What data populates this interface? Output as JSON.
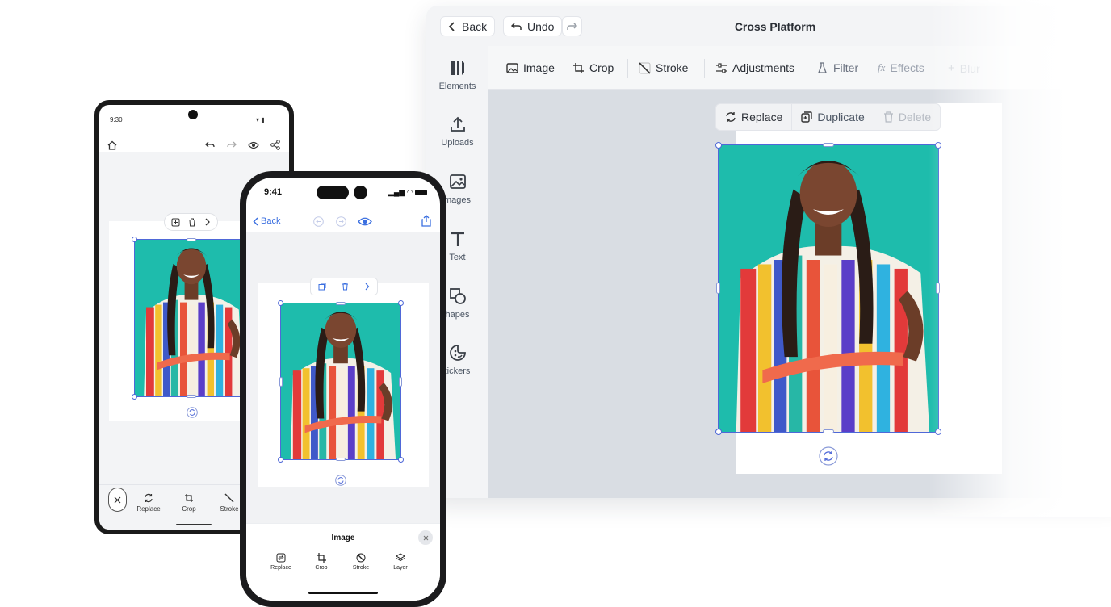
{
  "desktop": {
    "back_label": "Back",
    "undo_label": "Undo",
    "title": "Cross Platform",
    "sidebar": [
      {
        "label": "Elements",
        "icon": "elements-icon"
      },
      {
        "label": "Uploads",
        "icon": "upload-icon"
      },
      {
        "label": "mages",
        "icon": "image-icon"
      },
      {
        "label": "Text",
        "icon": "text-icon"
      },
      {
        "label": "hapes",
        "icon": "shapes-icon"
      },
      {
        "label": "tickers",
        "icon": "sticker-icon"
      }
    ],
    "tools": [
      {
        "label": "Image",
        "icon": "image-icon"
      },
      {
        "label": "Crop",
        "icon": "crop-icon"
      },
      {
        "label": "Stroke",
        "icon": "stroke-icon"
      },
      {
        "label": "Adjustments",
        "icon": "sliders-icon"
      },
      {
        "label": "Filter",
        "icon": "filter-icon"
      },
      {
        "label": "Effects",
        "icon": "fx-icon"
      },
      {
        "label": "Blur",
        "icon": "plus-icon"
      }
    ],
    "context": [
      {
        "label": "Replace",
        "icon": "replace-icon"
      },
      {
        "label": "Duplicate",
        "icon": "duplicate-icon"
      },
      {
        "label": "Delete",
        "icon": "trash-icon"
      }
    ]
  },
  "android": {
    "time": "9:30",
    "tools": [
      {
        "label": "Replace",
        "icon": "replace-icon"
      },
      {
        "label": "Crop",
        "icon": "crop-icon"
      },
      {
        "label": "Stroke",
        "icon": "stroke-icon"
      }
    ]
  },
  "ios": {
    "time": "9:41",
    "back_label": "Back",
    "sheet_title": "Image",
    "tools": [
      {
        "label": "Replace",
        "icon": "replace-icon"
      },
      {
        "label": "Crop",
        "icon": "crop-icon"
      },
      {
        "label": "Stroke",
        "icon": "stroke-icon"
      },
      {
        "label": "Layer",
        "icon": "layers-icon"
      }
    ]
  },
  "colors": {
    "accent": "#4f68d8",
    "ios_blue": "#3b6fe0",
    "photo_bg": "#1cbcab"
  }
}
